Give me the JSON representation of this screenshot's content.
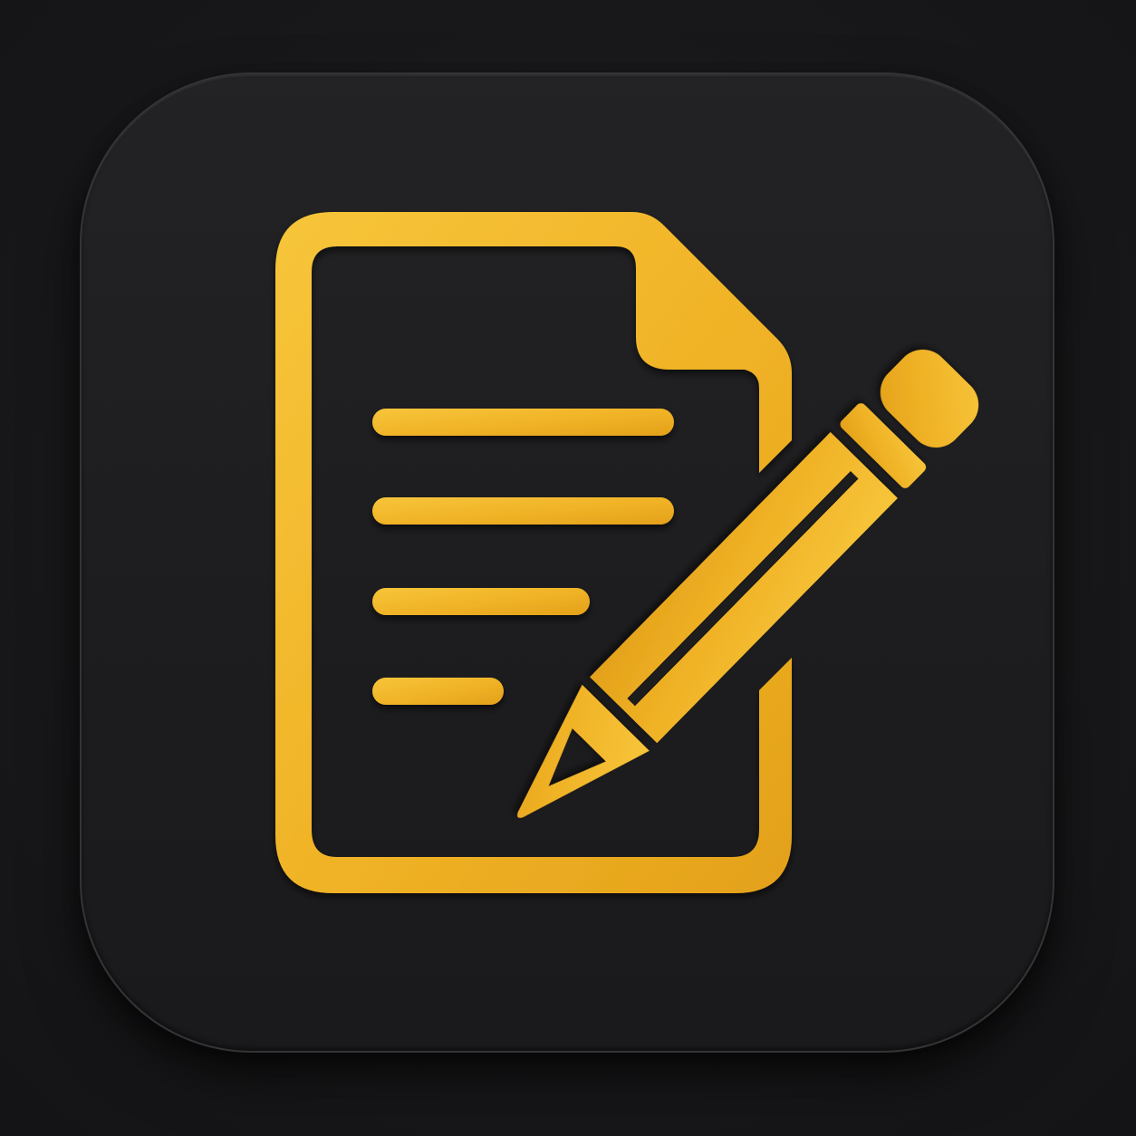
{
  "icon": {
    "name": "document-edit-icon",
    "symbol": "document-with-pencil",
    "colors": {
      "background": "#18181a",
      "tile": "#1f1f21",
      "tile_border": "#343437",
      "accent": "#f2b62a",
      "accent_shadow": "#a8760f"
    },
    "text_lines": 4
  }
}
